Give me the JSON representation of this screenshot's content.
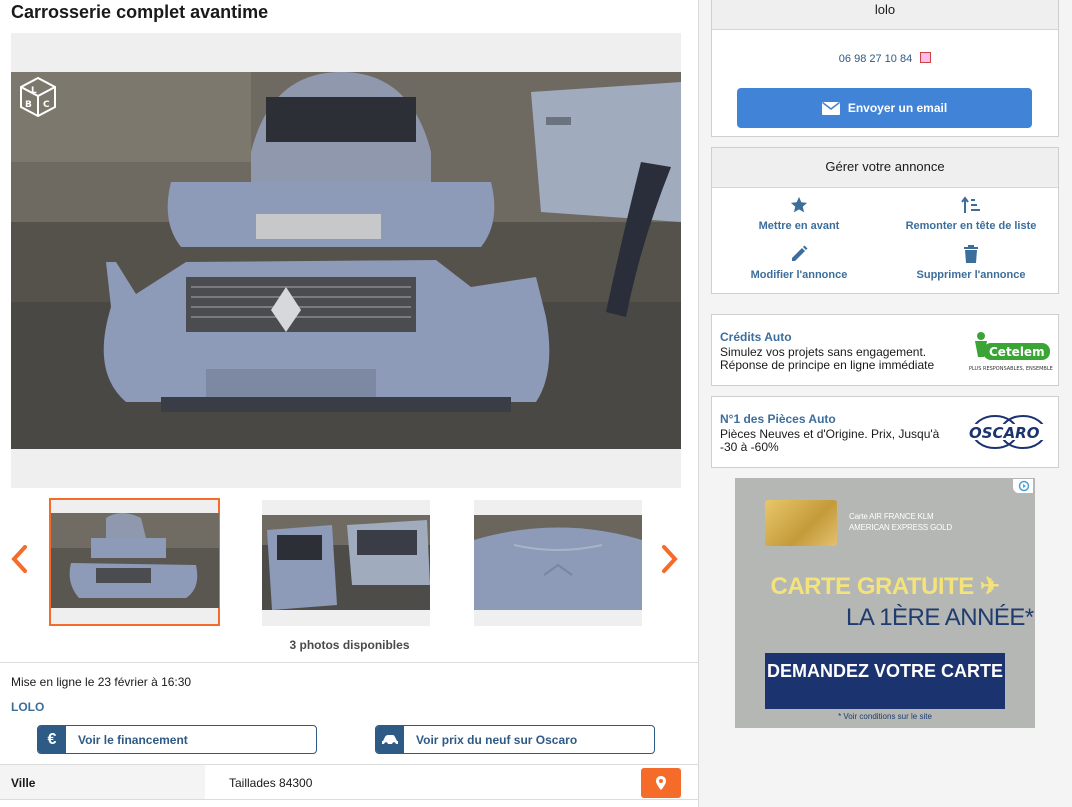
{
  "ad": {
    "title": "Carrosserie complet avantime",
    "photos_count": "3 photos disponibles",
    "posted": "Mise en ligne le 23 février à 16:30",
    "seller": "LOLO",
    "financing_label": "Voir le financement",
    "financing_icon": "€",
    "oscaro_label": "Voir prix du neuf sur Oscaro",
    "city_label": "Ville",
    "city_value": "Taillades 84300"
  },
  "contact": {
    "name": "lolo",
    "phone": "06 98 27 10 84",
    "email_label": "Envoyer un email"
  },
  "manage": {
    "title": "Gérer votre annonce",
    "feature": "Mettre en avant",
    "bump": "Remonter en tête de liste",
    "edit": "Modifier l'annonce",
    "delete": "Supprimer l'annonce"
  },
  "promos": {
    "credit": {
      "title": "Crédits Auto",
      "desc": "Simulez vos projets sans engagement. Réponse de principe en ligne immédiate",
      "brand": "Cetelem",
      "tagline": "PLUS RESPONSABLES, ENSEMBLE"
    },
    "parts": {
      "title": "N°1 des Pièces Auto",
      "desc": "Pièces Neuves et d'Origine. Prix, Jusqu'à -30 à -60%",
      "brand": "OSCARO"
    }
  },
  "banner": {
    "card_line1": "Carte AIR FRANCE KLM",
    "card_line2": "AMERICAN EXPRESS GOLD",
    "headline1": "CARTE GRATUITE",
    "headline2": "LA 1ÈRE ANNÉE*",
    "cta": "DEMANDEZ VOTRE CARTE",
    "conditions": "* Voir conditions sur le site"
  },
  "colors": {
    "accent": "#f56b2a",
    "link": "#3c6e9c",
    "primary_button": "#4183d7",
    "navy": "#2e5a86"
  }
}
